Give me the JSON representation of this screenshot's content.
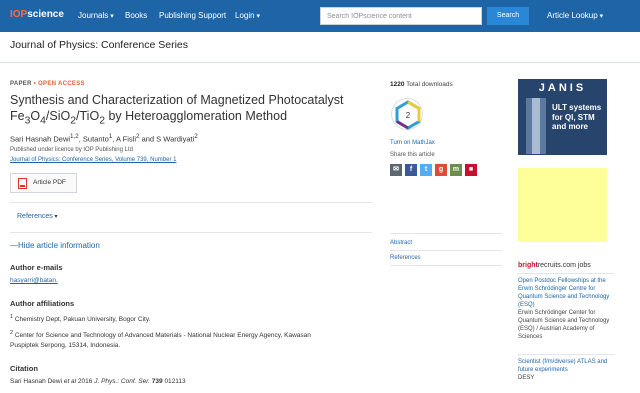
{
  "header": {
    "logo": {
      "prefix": "IOP",
      "suffix": "science"
    },
    "nav": {
      "journals": "Journals",
      "books": "Books",
      "publishing_support": "Publishing Support",
      "login": "Login"
    },
    "search": {
      "placeholder": "Search IOPscience content",
      "button": "Search"
    },
    "article_lookup": "Article Lookup"
  },
  "journal_title": "Journal of Physics: Conference Series",
  "article": {
    "label_type": "PAPER",
    "label_sep": " • ",
    "label_access": "OPEN ACCESS",
    "title_line1": "Synthesis and Characterization of Magnetized Photocatalyst",
    "title_line2": {
      "a": "Fe",
      "a_sub": "3",
      "b": "O",
      "b_sub": "4",
      "c": "/SiO",
      "c_sub": "2",
      "d": "/TiO",
      "d_sub": "2",
      "e": " by Heteroagglomeration Method"
    },
    "authors": {
      "a1": "Sari Hasnah Dewi",
      "a1_sup": "1,2",
      "a2": ", Sutanto",
      "a2_sup": "1",
      "a3": ", A Fisli",
      "a3_sup": "2",
      "a4": " and S Wardiyati",
      "a4_sup": "2"
    },
    "licence": "Published under licence by IOP Publishing Ltd",
    "journal_link": "Journal of Physics: Conference Series",
    "volume_link": "Volume 739",
    "number_link": "Number 1",
    "pdf_button": "Article PDF",
    "references": "References",
    "hide_info": "Hide article information",
    "author_emails_heading": "Author e-mails",
    "email": "hasyarri@batan.",
    "affiliations_heading": "Author affiliations",
    "affil1_num": "1",
    "affil1": " Chemistry Dept, Pakuan University, Bogor City.",
    "affil2_num": "2",
    "affil2_line1": " Center for Science and Technology of Advanced Materials - National Nuclear Energy Agency, Kawasan",
    "affil2_line2": "Puspiptek Serpong, 15314, Indonesia.",
    "citation_heading": "Citation",
    "citation": {
      "authors": "Sari Hasnah Dewi ",
      "etal": "et al",
      "year": " 2016 ",
      "journal": "J. Phys.: Conf. Ser.",
      "sp": " ",
      "volume": "739",
      "page": " 012113"
    }
  },
  "metrics": {
    "downloads_count": "1220",
    "downloads_label": " Total downloads",
    "badge_number": "2",
    "mathjax": "Turn on MathJax",
    "share_label": "Share this article"
  },
  "side_nav": {
    "abstract": "Abstract",
    "references": "References"
  },
  "ad": {
    "brand": "JANIS",
    "tagline": "ULT systems for QI, STM and more"
  },
  "jobs": {
    "header_bright": "bright",
    "header_rest": "recruits.com jobs",
    "job1_title": "Open Postdoc Fellowships at the Erwin Schrödinger Centre for Quantum Science and Technology (ESQ)",
    "job1_org": "Erwin Schrödinger Center for Quantum Science and Technology (ESQ) / Austrian Academy of Sciences",
    "job2_title": "Scientist (f/m/diverse) ATLAS and future experiments",
    "job2_org": "DESY"
  },
  "colors": {
    "header_bg": "#1e65a8",
    "link": "#1e65a8",
    "open_access": "#e0603a",
    "brightrecruits_red": "#c8102e"
  }
}
